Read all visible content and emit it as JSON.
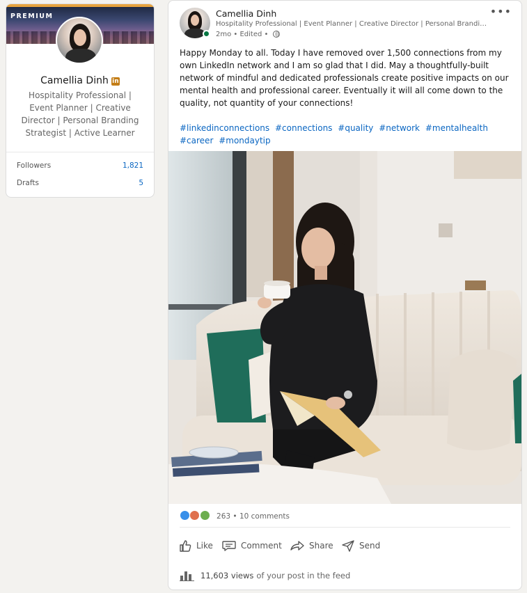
{
  "profile_card": {
    "premium_label": "PREMIUM",
    "name": "Camellia Dinh",
    "badge": "in",
    "headline": "Hospitality Professional | Event Planner | Creative Director | Personal Branding Strategist | Active Learner",
    "stats": [
      {
        "label": "Followers",
        "value": "1,821"
      },
      {
        "label": "Drafts",
        "value": "5"
      }
    ]
  },
  "post": {
    "author_name": "Camellia Dinh",
    "author_headline": "Hospitality Professional | Event Planner | Creative Director | Personal Brandin...",
    "meta": "2mo • Edited •",
    "more_label": "•••",
    "text": "Happy Monday to all. Today I have removed over 1,500 connections from my own LinkedIn network and I am so glad that I did. May a thoughtfully-built network of mindful and dedicated professionals create positive impacts on our mental health and professional career. Eventually it will all come down to the quality, not quantity of your connections!",
    "hashtags": [
      "#linkedinconnections",
      "#connections",
      "#quality",
      "#network",
      "#mentalhealth",
      "#career",
      "#mondaytip"
    ],
    "reactions": {
      "count": "263",
      "comments": "• 10 comments",
      "icons": [
        "like-icon",
        "love-icon",
        "support-icon"
      ]
    },
    "actions": {
      "like": "Like",
      "comment": "Comment",
      "share": "Share",
      "send": "Send"
    },
    "views": {
      "count": "11,603 views",
      "suffix": "of your post in the feed"
    }
  },
  "colors": {
    "link_blue": "#0a66c2",
    "premium_gold": "#e7a33e",
    "online_green": "#057642",
    "page_bg": "#f3f2ef"
  }
}
